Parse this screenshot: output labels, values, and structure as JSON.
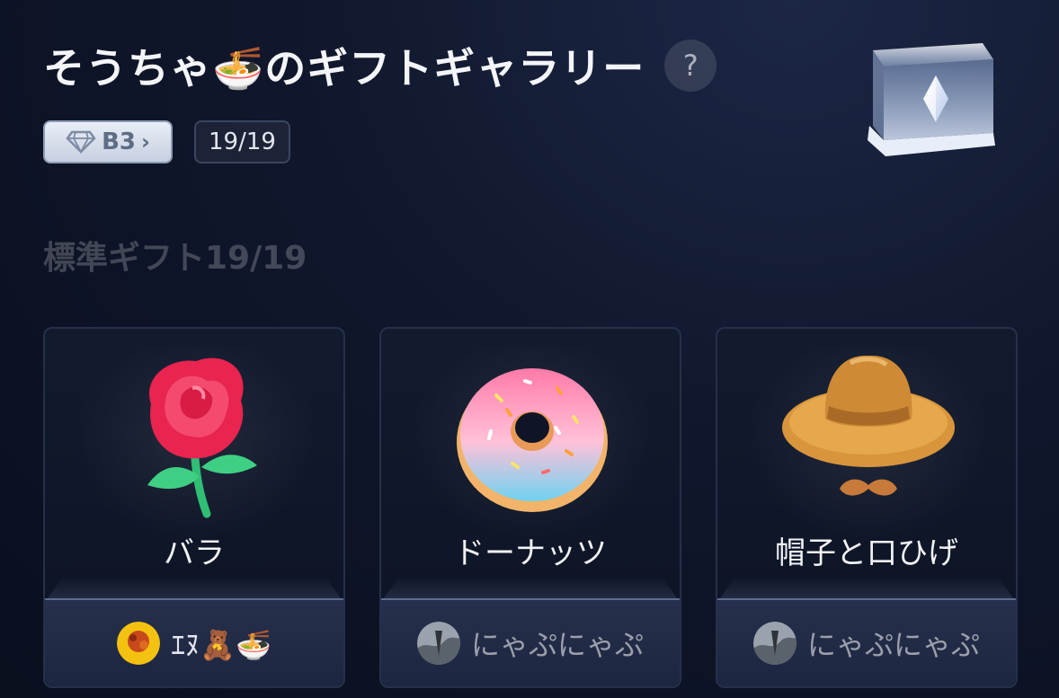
{
  "header": {
    "title": "そうちゃ🍜のギフトギャラリー",
    "help_label": "?"
  },
  "badges": {
    "level": "B3",
    "level_chevron": "›",
    "count": "19/19"
  },
  "section": {
    "title": "標準ギフト19/19"
  },
  "gifts": [
    {
      "name": "バラ",
      "sender": "ｴﾇ🧸🍜",
      "icon": "rose-icon"
    },
    {
      "name": "ドーナッツ",
      "sender": "にゃぷにゃぷ",
      "icon": "donut-icon"
    },
    {
      "name": "帽子と口ひげ",
      "sender": "にゃぷにゃぷ",
      "icon": "hat-mustache-icon"
    }
  ],
  "colors": {
    "background": "#10172c",
    "card": "#121a2e",
    "card_footer": "#26304c",
    "badge": "#e9eef6"
  }
}
